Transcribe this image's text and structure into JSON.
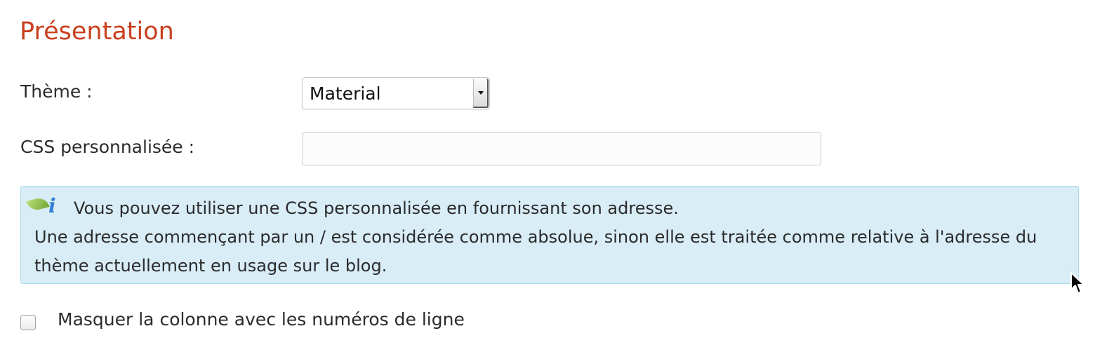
{
  "section": {
    "title": "Présentation"
  },
  "theme_field": {
    "label": "Thème :",
    "selected_value": "Material"
  },
  "css_field": {
    "label": "CSS personnalisée :",
    "value": "",
    "placeholder": ""
  },
  "info_box": {
    "line1": "Vous pouvez utiliser une CSS personnalisée en fournissant son adresse.",
    "line2": "Une adresse commençant par un / est considérée comme absolue, sinon elle est traitée comme relative à l'adresse du thème actuellement en usage sur le blog.",
    "icon": "info-leaf-icon"
  },
  "hide_line_numbers": {
    "label": "Masquer la colonne avec les numéros de ligne",
    "checked": false
  },
  "colors": {
    "title": "#c9401f",
    "info_background": "#d9edf7",
    "info_border": "#a9d9ea",
    "info_icon": "#2f7fd1",
    "leaf": "#6fa536"
  }
}
